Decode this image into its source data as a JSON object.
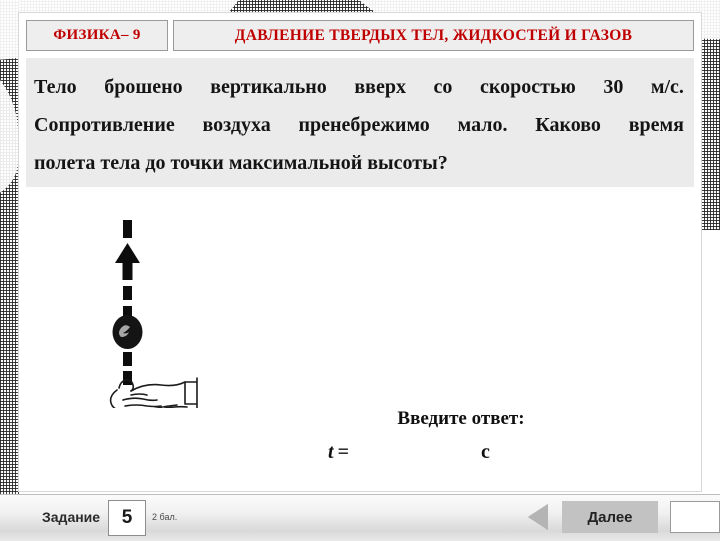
{
  "header": {
    "subject": "ФИЗИКА– 9",
    "topic": "ДАВЛЕНИЕ ТВЕРДЫХ ТЕЛ, ЖИДКОСТЕЙ И ГАЗОВ",
    "title_color": "#c00000"
  },
  "question": {
    "line1_words": [
      "Тело",
      "брошено",
      "вертикально",
      "вверх",
      "со",
      "скоростью",
      "30",
      "м/с."
    ],
    "line2_words": [
      "Сопротивление",
      "воздуха",
      "пренебрежимо",
      "мало.",
      "Каково",
      "время"
    ],
    "line3": "полета тела до точки максимальной высоты?",
    "full_text": "Тело брошено вертикально вверх со скоростью 30 м/с. Сопротивление воздуха пренебрежимо мало. Каково время полета тела до точки максимальной высоты?"
  },
  "illustration": {
    "description": "dashed upward arrow with thrown stone above an open hand",
    "arrow_icon": "arrow-up-dashed-icon",
    "ball_icon": "stone-icon",
    "hand_icon": "open-hand-icon"
  },
  "answer": {
    "prompt": "Введите ответ:",
    "variable": "t",
    "equals": "=",
    "value": "",
    "unit": "с"
  },
  "toolbar": {
    "task_label": "Задание",
    "task_number": "5",
    "points": "2 бал.",
    "back_icon": "triangle-left-icon",
    "next_label": "Далее",
    "entry_value": ""
  }
}
